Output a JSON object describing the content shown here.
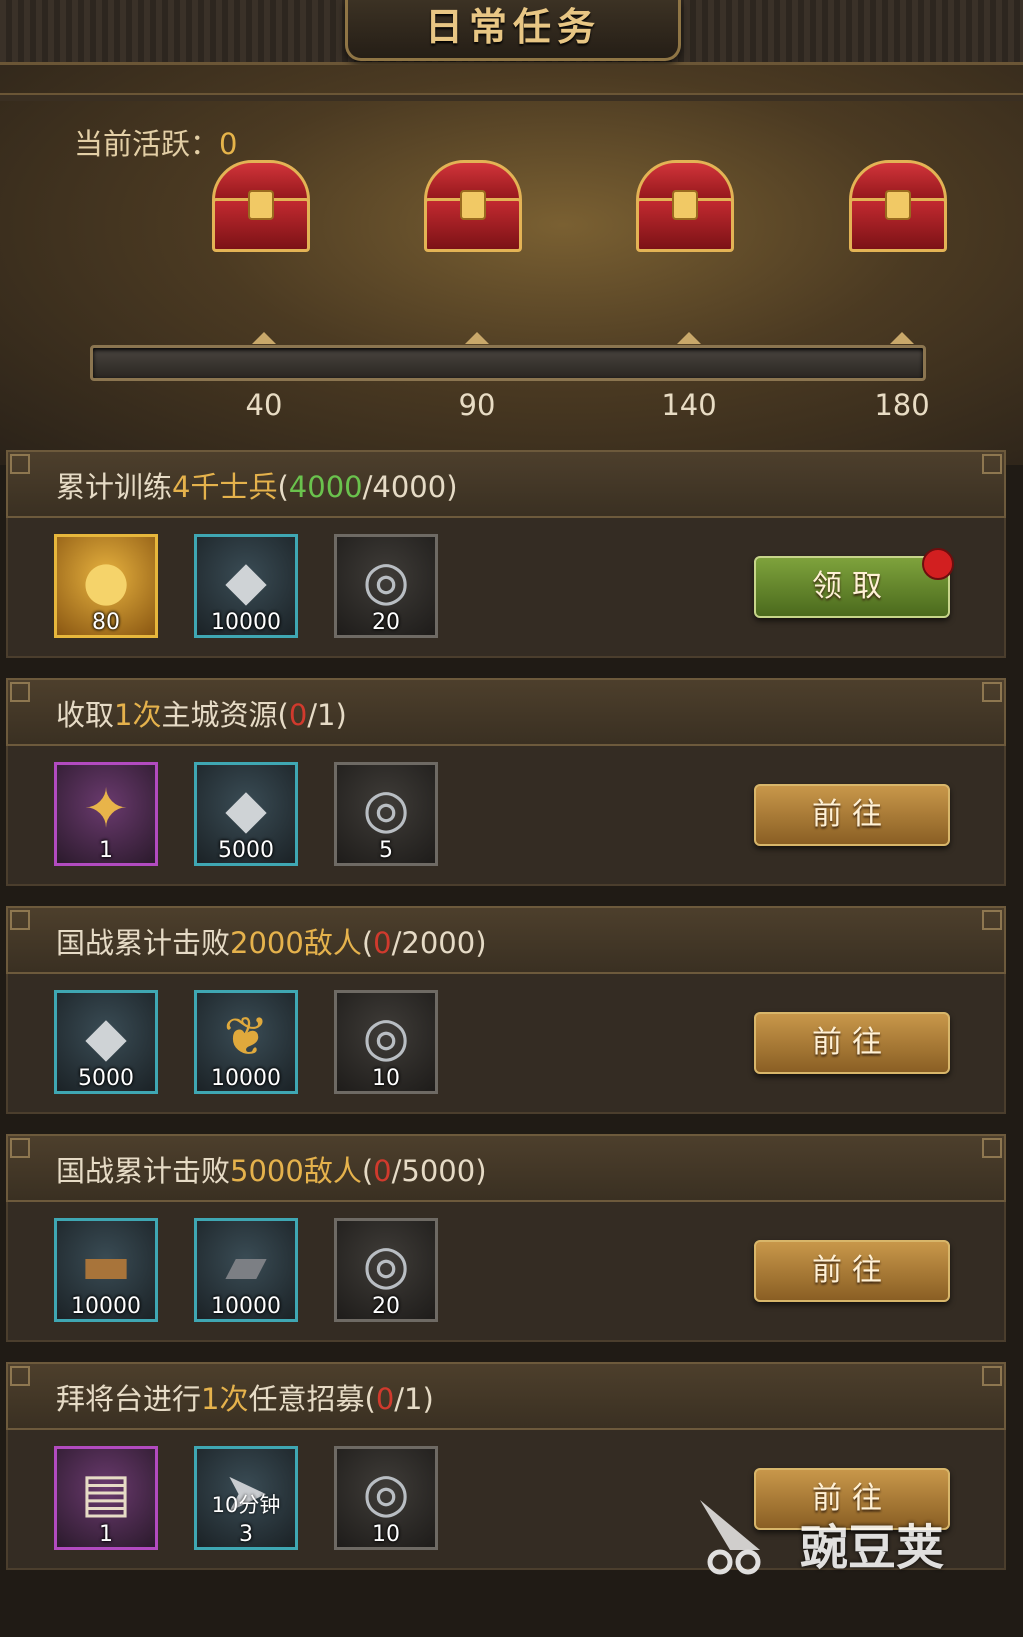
{
  "header": {
    "title": "日常任务"
  },
  "activity": {
    "label": "当前活跃：",
    "value": "0"
  },
  "progress": {
    "fill": 0,
    "milestones": [
      "40",
      "90",
      "140",
      "180"
    ]
  },
  "tasks": [
    {
      "title_pre": "累计训练",
      "title_hl": "4千士兵",
      "paren_open": "(",
      "progress_cur": "4000",
      "progress_sep": "/",
      "progress_max": "4000",
      "paren_close": ")",
      "status": "ok",
      "rewards": [
        {
          "icon": "gold-ingot-icon",
          "count": "80",
          "frame": "gold"
        },
        {
          "icon": "silver-coin-icon",
          "count": "10000",
          "frame": "blue"
        },
        {
          "icon": "dragon-coin-icon",
          "count": "20",
          "frame": "grey"
        }
      ],
      "button": "领取",
      "button_style": "green",
      "has_dot": true
    },
    {
      "title_pre": "收取",
      "title_hl": "1次",
      "title_post": "主城资源",
      "paren_open": "(",
      "progress_cur": "0",
      "progress_sep": "/",
      "progress_max": "1",
      "paren_close": ")",
      "status": "bad",
      "rewards": [
        {
          "icon": "harvest-wheat-icon",
          "count": "1",
          "frame": "purple"
        },
        {
          "icon": "silver-coin-icon",
          "count": "5000",
          "frame": "blue"
        },
        {
          "icon": "dragon-coin-icon",
          "count": "5",
          "frame": "grey"
        }
      ],
      "button": "前往",
      "button_style": "gold"
    },
    {
      "title_pre": "国战累计击败",
      "title_hl": "2000敌人",
      "paren_open": "(",
      "progress_cur": "0",
      "progress_sep": "/",
      "progress_max": "2000",
      "paren_close": ")",
      "status": "bad",
      "rewards": [
        {
          "icon": "silver-coin-icon",
          "count": "5000",
          "frame": "blue"
        },
        {
          "icon": "wheat-icon",
          "count": "10000",
          "frame": "blue"
        },
        {
          "icon": "dragon-coin-icon",
          "count": "10",
          "frame": "grey"
        }
      ],
      "button": "前往",
      "button_style": "gold"
    },
    {
      "title_pre": "国战累计击败",
      "title_hl": "5000敌人",
      "paren_open": "(",
      "progress_cur": "0",
      "progress_sep": "/",
      "progress_max": "5000",
      "paren_close": ")",
      "status": "bad",
      "rewards": [
        {
          "icon": "wood-log-icon",
          "count": "10000",
          "frame": "blue"
        },
        {
          "icon": "iron-ingot-icon",
          "count": "10000",
          "frame": "blue"
        },
        {
          "icon": "dragon-coin-icon",
          "count": "20",
          "frame": "grey"
        }
      ],
      "button": "前往",
      "button_style": "gold"
    },
    {
      "title_pre": "拜将台进行",
      "title_hl": "1次",
      "title_post": "任意招募",
      "paren_open": "(",
      "progress_cur": "0",
      "progress_sep": "/",
      "progress_max": "1",
      "paren_close": ")",
      "status": "bad",
      "rewards": [
        {
          "icon": "scroll-icon",
          "count": "1",
          "frame": "purple"
        },
        {
          "icon": "speedup-icon",
          "count": "3",
          "sublabel": "10分钟",
          "frame": "blue"
        },
        {
          "icon": "dragon-coin-icon",
          "count": "10",
          "frame": "grey"
        }
      ],
      "button": "前往",
      "button_style": "gold"
    }
  ],
  "watermark": {
    "text": "豌豆荚"
  }
}
